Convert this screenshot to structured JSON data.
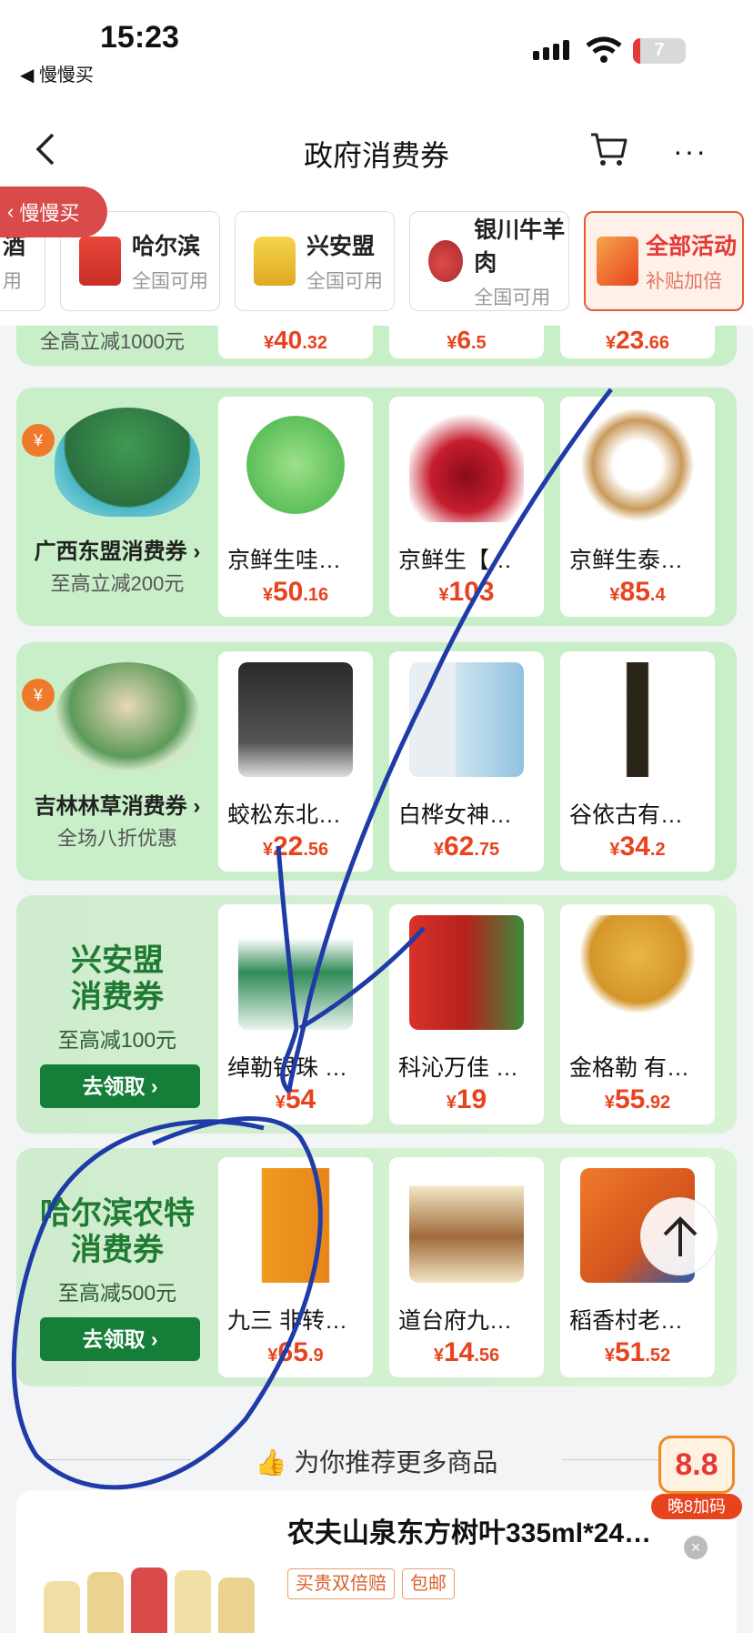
{
  "status_bar": {
    "time": "15:23",
    "back_app": "◀ 慢慢买",
    "battery": "7"
  },
  "nav": {
    "title": "政府消费券",
    "more": "···"
  },
  "back_pill": {
    "label": "慢慢买"
  },
  "city_tabs": [
    {
      "name": "酒",
      "sub": "用"
    },
    {
      "name": "哈尔滨",
      "sub": "全国可用"
    },
    {
      "name": "兴安盟",
      "sub": "全国可用"
    },
    {
      "name": "银川牛羊肉",
      "sub": "全国可用"
    },
    {
      "name": "全部活动",
      "sub": "补贴加倍",
      "active": true
    }
  ],
  "top_strip": {
    "note": "全高立减1000元",
    "prices": [
      {
        "y": "¥",
        "n": "40",
        "d": ".32"
      },
      {
        "y": "¥",
        "n": "6",
        "d": ".5"
      },
      {
        "y": "¥",
        "n": "23",
        "d": ".66"
      }
    ]
  },
  "sections": [
    {
      "title": "广西东盟消费券 ›",
      "subtitle": "至高立减200元",
      "items": [
        {
          "name": "京鲜生哇…",
          "y": "¥",
          "n": "50",
          "d": ".16"
        },
        {
          "name": "京鲜生【…",
          "y": "¥",
          "n": "103",
          "d": ""
        },
        {
          "name": "京鲜生泰…",
          "y": "¥",
          "n": "85",
          "d": ".4"
        }
      ]
    },
    {
      "title": "吉林林草消费券 ›",
      "subtitle": "全场八折优惠",
      "items": [
        {
          "name": "蛟松东北…",
          "y": "¥",
          "n": "22",
          "d": ".56"
        },
        {
          "name": "白桦女神…",
          "y": "¥",
          "n": "62",
          "d": ".75"
        },
        {
          "name": "谷依古有…",
          "y": "¥",
          "n": "34",
          "d": ".2"
        }
      ]
    },
    {
      "big": "兴安盟\n消费券",
      "subtitle": "至高减100元",
      "button": "去领取 ›",
      "items": [
        {
          "name": "绰勒银珠 …",
          "y": "¥",
          "n": "54",
          "d": ""
        },
        {
          "name": "科沁万佳 …",
          "y": "¥",
          "n": "19",
          "d": ""
        },
        {
          "name": "金格勒 有…",
          "y": "¥",
          "n": "55",
          "d": ".92"
        }
      ]
    },
    {
      "big": "哈尔滨农特\n消费券",
      "subtitle": "至高减500元",
      "button": "去领取 ›",
      "items": [
        {
          "name": "九三 非转…",
          "y": "¥",
          "n": "65",
          "d": ".9"
        },
        {
          "name": "道台府九…",
          "y": "¥",
          "n": "14",
          "d": ".56"
        },
        {
          "name": "稻香村老…",
          "y": "¥",
          "n": "51",
          "d": ".52"
        }
      ]
    }
  ],
  "recommend": {
    "title": "为你推荐更多商品"
  },
  "product": {
    "name": "农夫山泉东方树叶335ml*24…",
    "tags": [
      "买贵双倍赔",
      "包邮"
    ]
  },
  "reward": {
    "value": "8.8",
    "label": "晚8加码"
  },
  "colors": {
    "accent": "#e8431f",
    "green": "#157f3a",
    "annotation": "#1f3ba8"
  }
}
